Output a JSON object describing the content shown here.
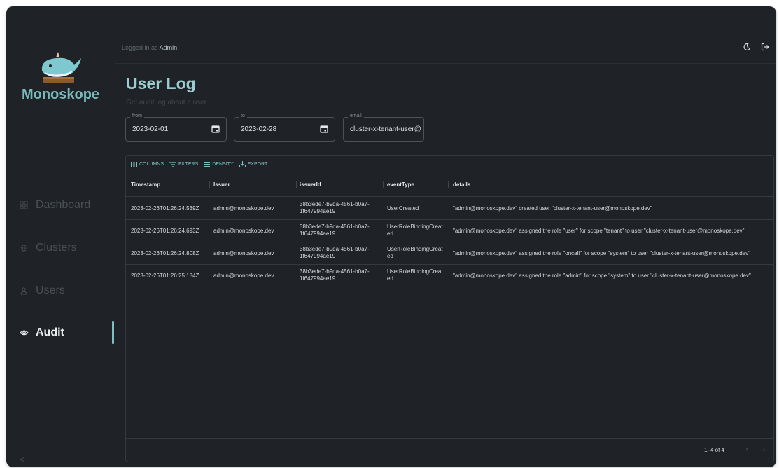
{
  "app": {
    "brand": "Monoskope",
    "logged_prefix": "Logged in as",
    "logged_user": "Admin"
  },
  "sidebar": {
    "items": [
      {
        "label": "Dashboard",
        "icon": "dashboard-icon"
      },
      {
        "label": "Clusters",
        "icon": "gear-icon"
      },
      {
        "label": "Users",
        "icon": "person-icon"
      },
      {
        "label": "Audit",
        "icon": "eye-icon"
      }
    ],
    "active": "Audit",
    "collapse_label": "<"
  },
  "page": {
    "title": "User Log",
    "subtitle": "Get audit log about a user"
  },
  "filters": {
    "from": {
      "label": "from",
      "value": "2023-02-01"
    },
    "to": {
      "label": "to",
      "value": "2023-02-28"
    },
    "email": {
      "label": "email",
      "value": "cluster-x-tenant-user@n"
    }
  },
  "toolbar": {
    "columns": "COLUMNS",
    "filters": "FILTERS",
    "density": "DENSITY",
    "export": "EXPORT"
  },
  "table": {
    "columns": [
      "Timestamp",
      "Issuer",
      "issuerId",
      "eventType",
      "details"
    ],
    "rows": [
      {
        "timestamp": "2023-02-26T01:26:24.539Z",
        "issuer": "admin@monoskope.dev",
        "issuer_id_1": "38b3ede7-b9da-4561-b0a7-",
        "issuer_id_2": "1f647994ae19",
        "event_1": "UserCreated",
        "event_2": "",
        "details": "\"admin@monoskope.dev\" created user \"cluster-x-tenant-user@monoskope.dev\""
      },
      {
        "timestamp": "2023-02-26T01:26:24.693Z",
        "issuer": "admin@monoskope.dev",
        "issuer_id_1": "38b3ede7-b9da-4561-b0a7-",
        "issuer_id_2": "1f647994ae19",
        "event_1": "UserRoleBindingCreat",
        "event_2": "ed",
        "details": "\"admin@monoskope.dev\" assigned the role \"user\" for scope \"tenant\" to user \"cluster-x-tenant-user@monoskope.dev\""
      },
      {
        "timestamp": "2023-02-26T01:26:24.808Z",
        "issuer": "admin@monoskope.dev",
        "issuer_id_1": "38b3ede7-b9da-4561-b0a7-",
        "issuer_id_2": "1f647994ae19",
        "event_1": "UserRoleBindingCreat",
        "event_2": "ed",
        "details": "\"admin@monoskope.dev\" assigned the role \"oncall\" for scope \"system\" to user \"cluster-x-tenant-user@monoskope.dev\""
      },
      {
        "timestamp": "2023-02-26T01:26:25.184Z",
        "issuer": "admin@monoskope.dev",
        "issuer_id_1": "38b3ede7-b9da-4561-b0a7-",
        "issuer_id_2": "1f647994ae19",
        "event_1": "UserRoleBindingCreat",
        "event_2": "ed",
        "details": "\"admin@monoskope.dev\" assigned the role \"admin\" for scope \"system\" to user \"cluster-x-tenant-user@monoskope.dev\""
      }
    ]
  },
  "pagination": {
    "range": "1–4 of 4",
    "prev": "‹",
    "next": "›"
  },
  "colors": {
    "accent": "#7fbec2",
    "background": "#1f2327",
    "brand": "#79b9bc"
  }
}
